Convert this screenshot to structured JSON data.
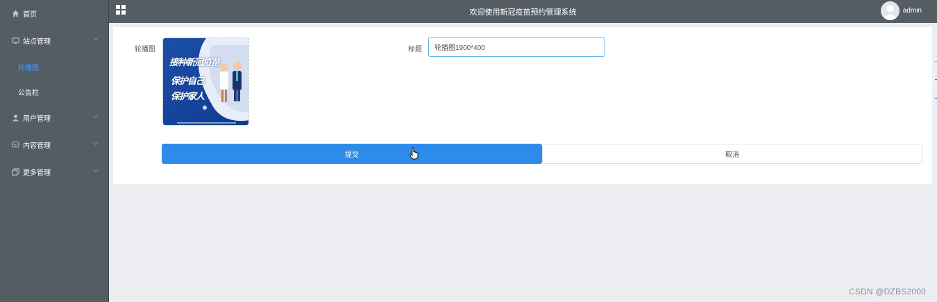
{
  "sidebar": {
    "home": {
      "label": "首页",
      "icon": "home-icon"
    },
    "site": {
      "label": "站点管理",
      "icon": "monitor-icon",
      "expanded": true,
      "children": [
        {
          "label": "轮播图",
          "active": true
        },
        {
          "label": "公告栏"
        }
      ]
    },
    "user": {
      "label": "用户管理",
      "icon": "user-icon"
    },
    "content": {
      "label": "内容管理",
      "icon": "chat-icon"
    },
    "more": {
      "label": "更多管理",
      "icon": "copy-icon"
    }
  },
  "header": {
    "title": "欢迎使用新冠疫苗预约管理系统",
    "username": "admin"
  },
  "form": {
    "banner_label": "轮播图",
    "banner_image_text": [
      "接种新冠疫苗",
      "保护自己",
      "保护家人"
    ],
    "title_label": "标题",
    "title_value": "轮播图1900*400",
    "submit_label": "提交",
    "cancel_label": "取消"
  },
  "watermark": "CSDN @DZBS2000",
  "colors": {
    "sidebar_bg": "#545c64",
    "active": "#409eff",
    "primary": "#2d8cea",
    "page_bg": "#edeef2"
  }
}
